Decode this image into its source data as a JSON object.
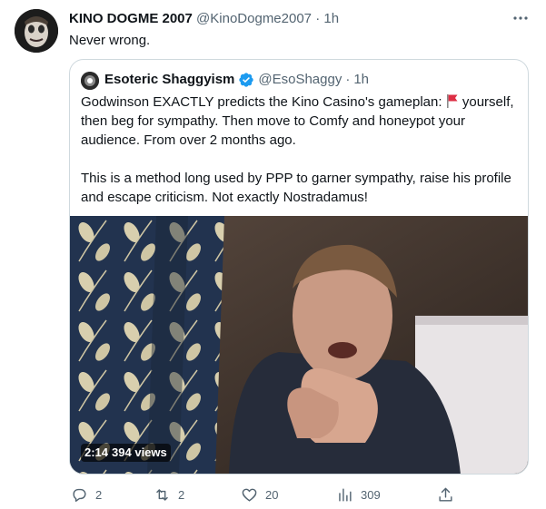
{
  "tweet": {
    "author_name": "KINO DOGME 2007",
    "author_handle": "@KinoDogme2007",
    "separator": "·",
    "time": "1h",
    "text": "Never wrong.",
    "avatar_icon": "user-avatar",
    "more_icon": "more-horizontal-icon"
  },
  "quoted_tweet": {
    "author_name": "Esoteric Shaggyism",
    "author_handle": "@EsoShaggy",
    "separator": "·",
    "time": "1h",
    "verified_icon": "verified-badge-icon",
    "verified_color": "#1d9bf0",
    "paragraph1_before_flag": "Godwinson EXACTLY predicts the Kino Casino's gameplan: ",
    "flag_icon": "red-flag-emoji",
    "paragraph1_after_flag": " yourself, then beg for sympathy. Then move to Comfy and honeypot your audience. From over 2 months ago.",
    "paragraph2": "This is a method long used by PPP to garner sympathy, raise his profile and escape criticism. Not exactly Nostradamus!",
    "media": {
      "type": "video",
      "duration": "2:14",
      "views": "394 views"
    }
  },
  "actions": {
    "reply_count": "2",
    "retweet_count": "2",
    "like_count": "20",
    "views_count": "309",
    "icon_color": "#536471"
  }
}
